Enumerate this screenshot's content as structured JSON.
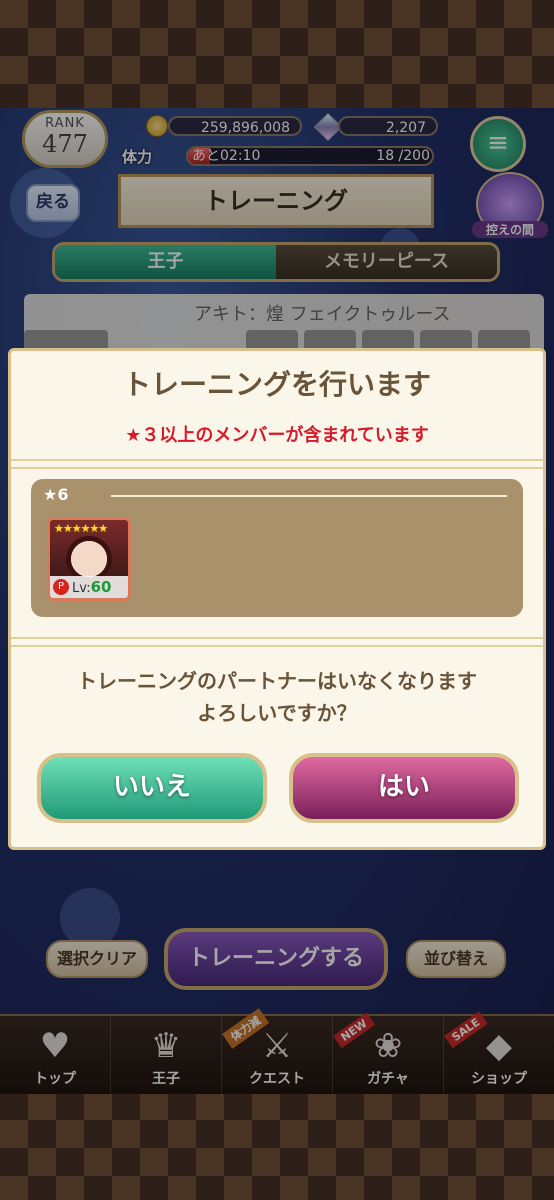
{
  "status": {
    "rank_label": "RANK",
    "rank_value": "477",
    "coins": "259,896,008",
    "gems": "2,207",
    "stamina_label": "体力",
    "stamina_recover": "あと02:10",
    "stamina_count": "18 /200",
    "stamina_fraction": 0.09
  },
  "header": {
    "back_label": "戻る",
    "title": "トレーニング",
    "room_label": "控えの間"
  },
  "tabs": [
    {
      "label": "王子"
    },
    {
      "label": "メモリーピース"
    }
  ],
  "list": {
    "selected_name": "アキト：煌 フェイクトゥルース"
  },
  "modal": {
    "title": "トレーニングを行います",
    "warning": "★３以上のメンバーが含まれています",
    "rarity_label": "★6",
    "card": {
      "stars": "★★★★★★",
      "lv_label": "Lv:",
      "lv_value": "60",
      "badge": "P"
    },
    "message_line1": "トレーニングのパートナーはいなくなります",
    "message_line2": "よろしいですか？",
    "no_label": "いいえ",
    "yes_label": "はい"
  },
  "controls": {
    "clear_label": "選択クリア",
    "train_label": "トレーニングする",
    "sort_label": "並び替え"
  },
  "nav": [
    {
      "label": "トップ",
      "icon": "heart-icon",
      "glyph": "♥"
    },
    {
      "label": "王子",
      "icon": "crown-icon",
      "glyph": "♛"
    },
    {
      "label": "クエスト",
      "icon": "quest-icon",
      "glyph": "⚔",
      "tag": "体力減"
    },
    {
      "label": "ガチャ",
      "icon": "gacha-icon",
      "glyph": "❀",
      "tag": "NEW"
    },
    {
      "label": "ショップ",
      "icon": "shop-icon",
      "glyph": "◆",
      "tag": "SALE"
    }
  ]
}
